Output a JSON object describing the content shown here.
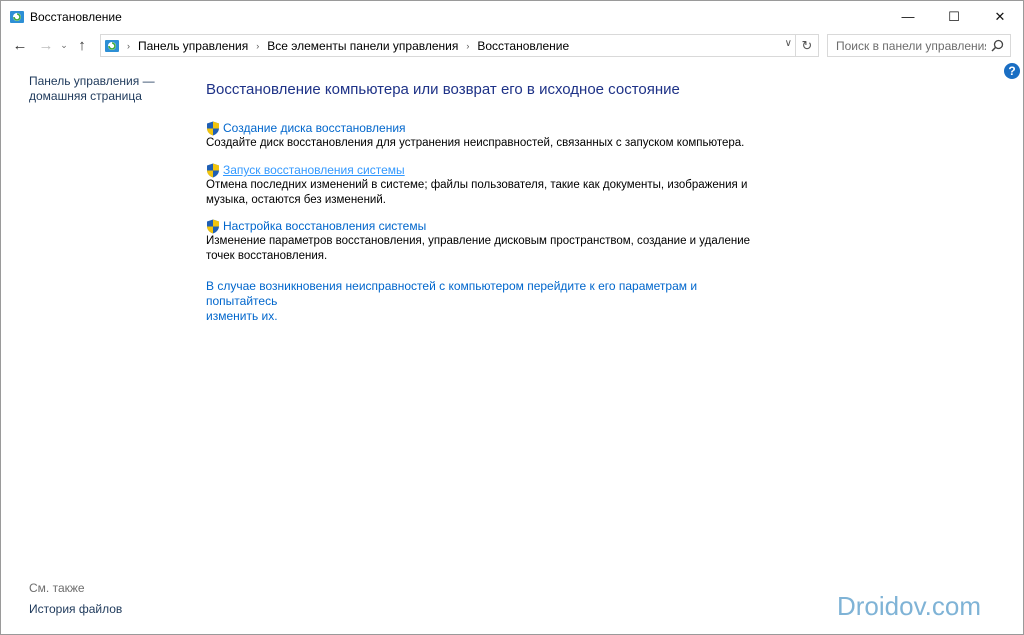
{
  "window": {
    "title": "Восстановление",
    "controls": {
      "minimize": "—",
      "maximize": "☐",
      "close": "✕"
    }
  },
  "nav": {
    "back": "←",
    "forward": "→",
    "recent": "⌄",
    "up": "↑",
    "breadcrumbs": [
      "Панель управления",
      "Все элементы панели управления",
      "Восстановление"
    ],
    "separator": "›",
    "dropdown": "∨",
    "refresh": "↻"
  },
  "search": {
    "placeholder": "Поиск в панели управления"
  },
  "help": {
    "label": "?"
  },
  "sidebar": {
    "home_link_line1": "Панель управления —",
    "home_link_line2": "домашняя страница",
    "see_also": "См. также",
    "file_history": "История файлов"
  },
  "main": {
    "title": "Восстановление компьютера или возврат его в исходное состояние",
    "tasks": [
      {
        "label": "Создание диска восстановления",
        "desc": "Создайте диск восстановления для устранения неисправностей, связанных с запуском компьютера."
      },
      {
        "label": "Запуск восстановления системы",
        "desc_line1": "Отмена последних изменений в системе; файлы пользователя, такие как документы, изображения и",
        "desc_line2": "музыка, остаются без изменений."
      },
      {
        "label": "Настройка восстановления системы",
        "desc_line1": "Изменение параметров восстановления, управление дисковым пространством, создание и удаление",
        "desc_line2": "точек восстановления."
      }
    ],
    "trouble_line1": "В случае возникновения неисправностей с компьютером перейдите к его параметрам и попытайтесь",
    "trouble_line2": "изменить их."
  },
  "watermark": "Droidov.com",
  "colors": {
    "link": "#0066cc",
    "title": "#1e3287",
    "help": "#1a6ec3"
  }
}
